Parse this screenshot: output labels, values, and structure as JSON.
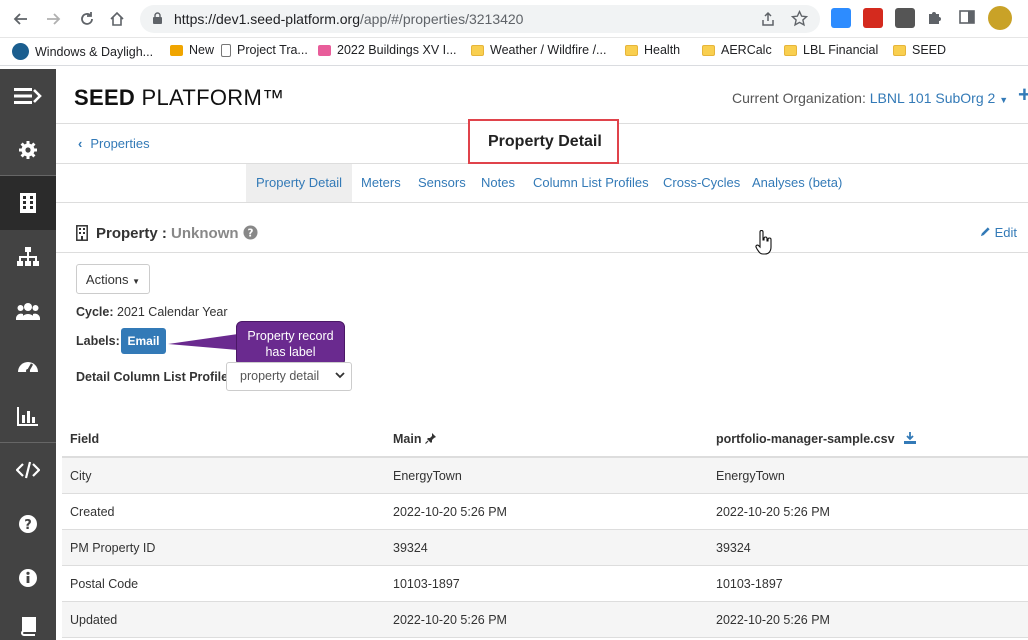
{
  "browser": {
    "url_host": "https://dev1.seed-platform.org",
    "url_path": "/app/#/properties/3213420",
    "bookmarks": [
      {
        "label": "Windows & Dayligh..."
      },
      {
        "label": "New"
      },
      {
        "label": "Project Tra..."
      },
      {
        "label": "2022 Buildings XV I..."
      },
      {
        "label": "Weather / Wildfire /..."
      },
      {
        "label": "Health"
      },
      {
        "label": "AERCalc"
      },
      {
        "label": "LBL Financial"
      },
      {
        "label": "SEED"
      }
    ]
  },
  "header": {
    "logo_bold": "SEED",
    "logo_rest": " PLATFORM™",
    "org_label": "Current Organization:",
    "org_value": "LBNL 101 SubOrg 2"
  },
  "subheader": {
    "back_label": "Properties",
    "page_title": "Property Detail"
  },
  "tabs": [
    {
      "label": "Property Detail"
    },
    {
      "label": "Meters"
    },
    {
      "label": "Sensors"
    },
    {
      "label": "Notes"
    },
    {
      "label": "Column List Profiles"
    },
    {
      "label": "Cross-Cycles"
    },
    {
      "label": "Analyses (beta)"
    }
  ],
  "property": {
    "title_label": "Property :",
    "title_value": "Unknown",
    "edit_label": "Edit",
    "actions_label": "Actions",
    "cycle_label": "Cycle:",
    "cycle_value": "2021 Calendar Year",
    "labels_label": "Labels:",
    "label_badge": "Email",
    "callout_line1": "Property record",
    "callout_line2": "has label",
    "profile_label": "Detail Column List Profile:",
    "profile_value": "property detail"
  },
  "table": {
    "headers": [
      "Field",
      "Main",
      "portfolio-manager-sample.csv"
    ],
    "rows": [
      {
        "field": "City",
        "main": "EnergyTown",
        "csv": "EnergyTown"
      },
      {
        "field": "Created",
        "main": "2022-10-20 5:26 PM",
        "csv": "2022-10-20 5:26 PM"
      },
      {
        "field": "PM Property ID",
        "main": "39324",
        "csv": "39324"
      },
      {
        "field": "Postal Code",
        "main": "10103-1897",
        "csv": "10103-1897"
      },
      {
        "field": "Updated",
        "main": "2022-10-20 5:26 PM",
        "csv": "2022-10-20 5:26 PM"
      }
    ]
  },
  "colors": {
    "link": "#337ab7",
    "sidebar": "#434343",
    "highlight_box": "#e0434b",
    "callout": "#6a2a8f"
  }
}
